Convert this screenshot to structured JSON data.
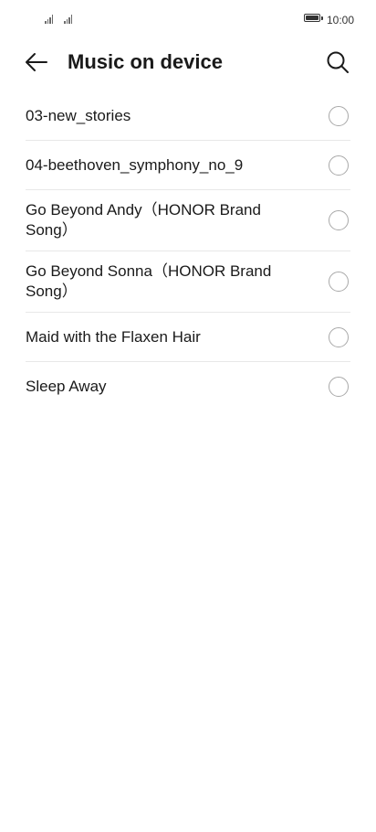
{
  "status_bar": {
    "time": "10:00",
    "signal_icons": [
      "signal-icon",
      "signal-icon"
    ],
    "battery_icon": "battery-full-icon"
  },
  "app_bar": {
    "back_icon": "arrow-left-icon",
    "title": "Music on device",
    "search_icon": "search-icon"
  },
  "songs": [
    {
      "label": "03-new_stories",
      "selected": false
    },
    {
      "label": "04-beethoven_symphony_no_9",
      "selected": false
    },
    {
      "label": "Go Beyond Andy（HONOR Brand Song）",
      "selected": false
    },
    {
      "label": "Go Beyond Sonna（HONOR Brand Song）",
      "selected": false
    },
    {
      "label": "Maid with the Flaxen Hair",
      "selected": false
    },
    {
      "label": "Sleep Away",
      "selected": false
    }
  ],
  "colors": {
    "text": "#1a1a1a",
    "divider": "#e8e8e8",
    "radio_border": "#a8a8a8",
    "background": "#ffffff"
  }
}
